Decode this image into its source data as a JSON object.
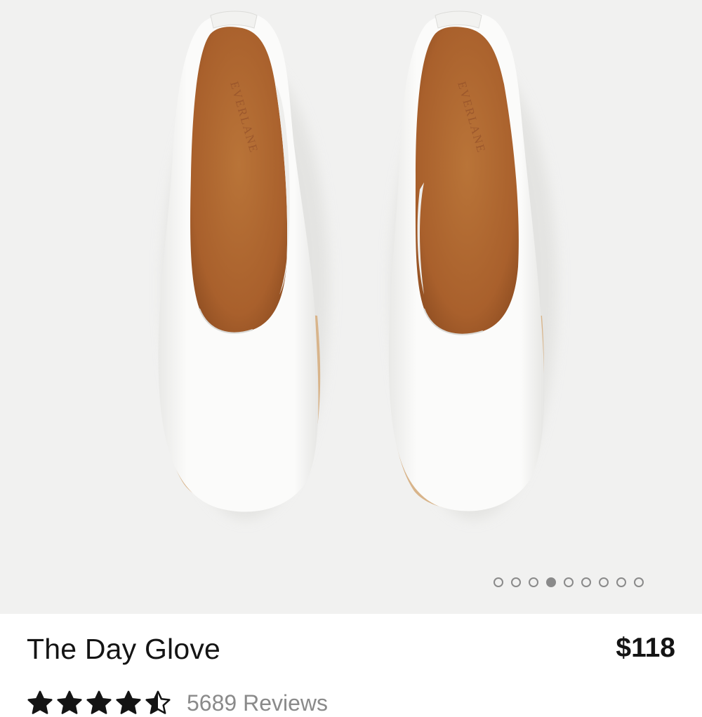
{
  "product": {
    "title": "The Day Glove",
    "price": "$118",
    "image_description_label": "white-leather-flats-top-view",
    "shoe_brand_stamp": "EVERLANE",
    "rating": {
      "stars": 4.5,
      "max": 5,
      "reviews_label": "5689 Reviews"
    }
  },
  "gallery": {
    "total_images": 9,
    "active_index": 3
  },
  "colors": {
    "background": "#f1f1f0",
    "insole": "#b36a34",
    "leather": "#fbfbfa",
    "dot": "#8a8a8a",
    "text": "#141414",
    "muted": "#8a8a8a"
  }
}
